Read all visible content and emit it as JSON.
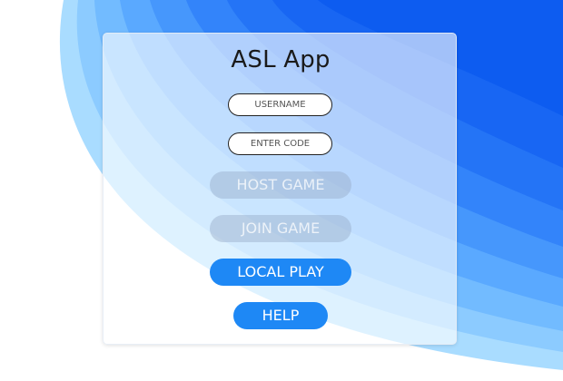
{
  "app": {
    "title": "ASL App"
  },
  "form": {
    "username_placeholder": "USERNAME",
    "code_placeholder": "ENTER CODE"
  },
  "buttons": {
    "host_game": "HOST GAME",
    "join_game": "JOIN GAME",
    "local_play": "LOCAL PLAY",
    "help": "HELP"
  },
  "colors": {
    "primary": "#1e88f5",
    "disabled": "#b9c6da",
    "background_dark": "#0a5cf0",
    "background_light": "#a9dcff"
  }
}
